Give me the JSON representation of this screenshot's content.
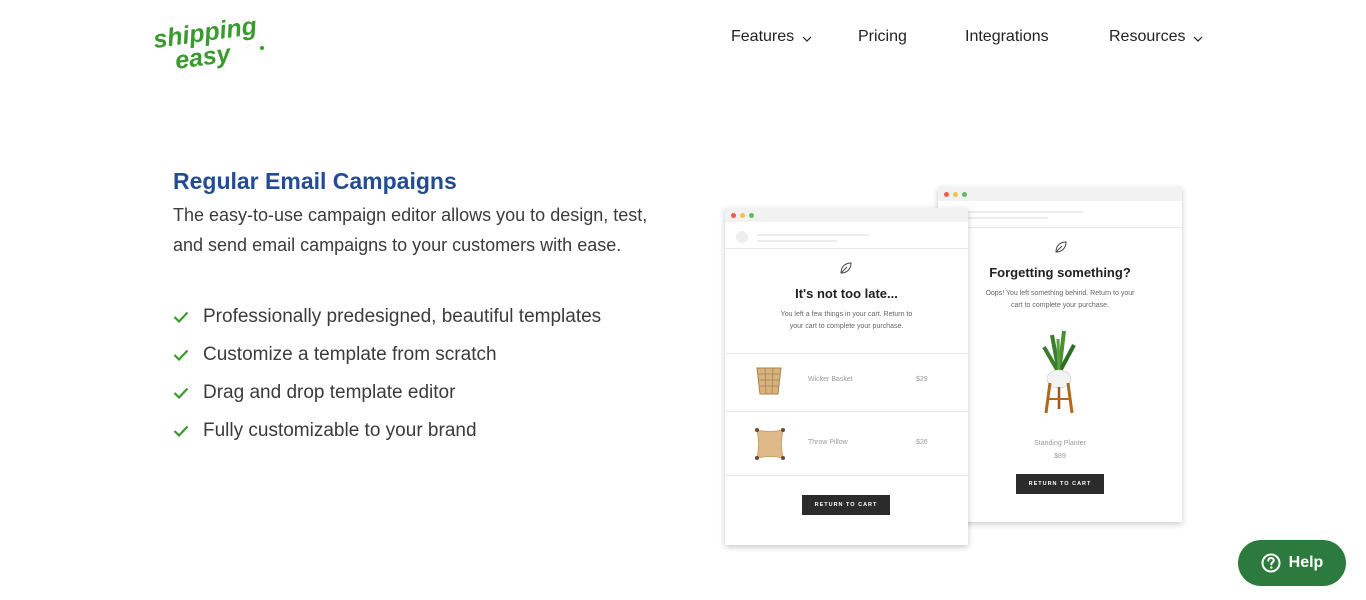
{
  "header": {
    "logo_text": "shipping easy",
    "nav": [
      {
        "label": "Features",
        "has_dropdown": true
      },
      {
        "label": "Pricing",
        "has_dropdown": false
      },
      {
        "label": "Integrations",
        "has_dropdown": false
      },
      {
        "label": "Resources",
        "has_dropdown": true
      }
    ]
  },
  "content": {
    "title": "Regular Email Campaigns",
    "description": "The easy-to-use campaign editor allows you to design, test, and send email campaigns to your customers with ease.",
    "features": [
      "Professionally predesigned, beautiful templates",
      "Customize a template from scratch",
      "Drag and drop template editor",
      "Fully customizable to your brand"
    ]
  },
  "mockup_front": {
    "title": "It's not too late...",
    "subtitle": "You left a few things in your cart. Return to your cart to complete your purchase.",
    "products": [
      {
        "name": "Wicker Basket",
        "price": "$29"
      },
      {
        "name": "Throw Pillow",
        "price": "$26"
      }
    ],
    "button": "RETURN TO CART"
  },
  "mockup_back": {
    "title": "Forgetting something?",
    "subtitle": "Oops! You left something behind. Return to your cart to complete your purchase.",
    "product_name": "Standing Planter",
    "product_price": "$89",
    "button": "RETURN TO CART"
  },
  "help": {
    "label": "Help"
  },
  "colors": {
    "brand_green": "#3a9a2e",
    "title_blue": "#244c94",
    "help_green": "#2c7a3d",
    "window_dot_red": "#f25a4a",
    "window_dot_yellow": "#f5c242",
    "window_dot_green": "#5ac05a"
  },
  "icons": [
    "chevron-down-icon",
    "check-icon",
    "leaf-icon",
    "question-circle-icon"
  ]
}
